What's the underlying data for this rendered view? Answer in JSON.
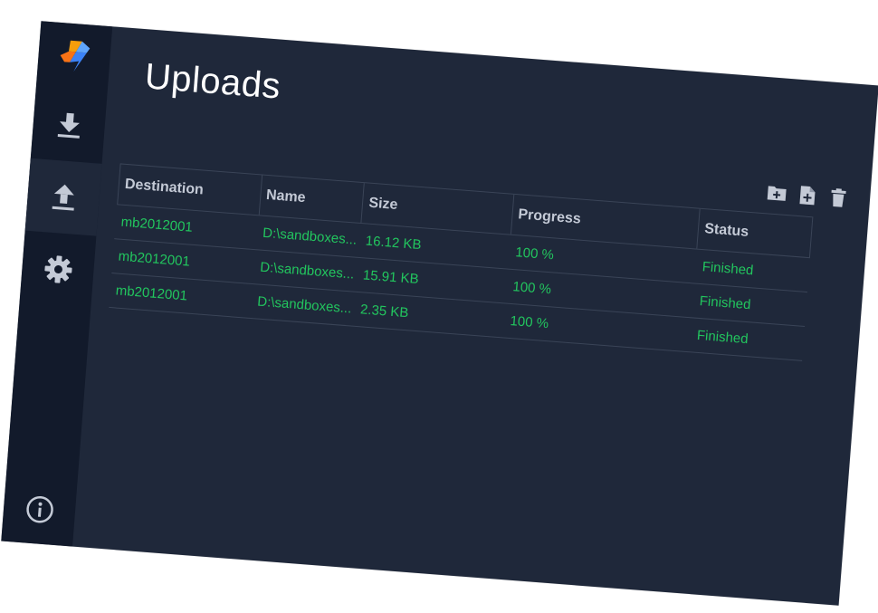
{
  "app": {
    "colors": {
      "sidebar_bg": "#121a2b",
      "main_bg": "#1f283a",
      "accent_green": "#22c55e",
      "header_text": "#c4cad6",
      "icon_gray": "#c4cad6"
    }
  },
  "sidebar": {
    "logo_icon": "lightning-logo-icon",
    "items": [
      {
        "icon": "download-icon",
        "name": "downloads",
        "active": false
      },
      {
        "icon": "upload-icon",
        "name": "uploads",
        "active": true
      },
      {
        "icon": "gear-icon",
        "name": "settings",
        "active": false
      }
    ],
    "info_icon": "info-icon"
  },
  "page": {
    "title": "Uploads"
  },
  "toolbar": {
    "buttons": [
      {
        "icon": "folder-add-icon"
      },
      {
        "icon": "file-add-icon"
      },
      {
        "icon": "trash-icon"
      }
    ]
  },
  "table": {
    "columns": [
      "Destination",
      "Name",
      "Size",
      "Progress",
      "Status"
    ],
    "rows": [
      {
        "destination": "mb2012001",
        "name": "D:\\sandboxes...",
        "size": "16.12 KB",
        "progress": "100 %",
        "status": "Finished"
      },
      {
        "destination": "mb2012001",
        "name": "D:\\sandboxes...",
        "size": "15.91 KB",
        "progress": "100 %",
        "status": "Finished"
      },
      {
        "destination": "mb2012001",
        "name": "D:\\sandboxes...",
        "size": "2.35 KB",
        "progress": "100 %",
        "status": "Finished"
      }
    ]
  }
}
